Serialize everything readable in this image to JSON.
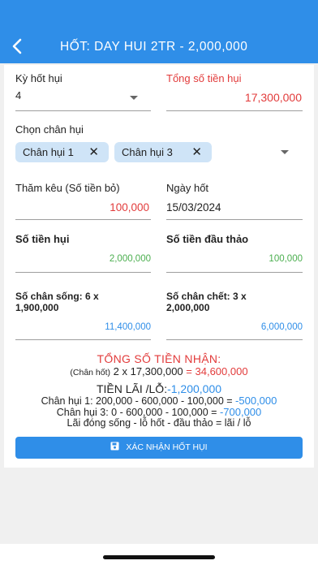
{
  "header": {
    "title": "HỐT: DAY HUI 2TR - 2,000,000"
  },
  "ky_hot": {
    "label": "Kỳ hốt hụi",
    "value": "4"
  },
  "tong_so_tien": {
    "label": "Tổng số tiền hụi",
    "value": "17,300,000"
  },
  "chon_chan": {
    "label": "Chọn chân hụi",
    "chips": [
      {
        "label": "Chân hụi 1"
      },
      {
        "label": "Chân hụi 3"
      }
    ]
  },
  "tham_keu": {
    "label": "Thăm kêu (Số tiền bỏ)",
    "value": "100,000"
  },
  "ngay_hot": {
    "label": "Ngày hốt",
    "value": "15/03/2024"
  },
  "so_tien_hui": {
    "label": "Số tiền hụi",
    "value": "2,000,000"
  },
  "so_tien_dau_thao": {
    "label": "Số tiền đầu thảo",
    "value": "100,000"
  },
  "so_chan_song": {
    "label_line1": "Số chân sống:  6 x",
    "label_line2": "1,900,000",
    "value": "11,400,000"
  },
  "so_chan_chet": {
    "label_line1": "Số chân chết: 3 x",
    "label_line2": "2,000,000",
    "value": "6,000,000"
  },
  "summary": {
    "tong_nhan_title": "TỔNG SỐ TIỀN NHẬN:",
    "tong_nhan_prefix": "(Chân hốt)",
    "tong_nhan_formula": "2 x 17,300,000",
    "tong_nhan_result": "= 34,600,000",
    "lai_lo_label": "TIỀN LÃI /LỖ:",
    "lai_lo_value": "-1,200,000",
    "chan1_label": "Chân hụi 1:  200,000 - 600,000 - 100,000 =",
    "chan1_value": "-500,000",
    "chan3_label": "Chân hụi 3:  0 - 600,000 - 100,000 =",
    "chan3_value": "-700,000",
    "note": "Lãi đóng sống - lỗ hốt - đầu thảo = lãi / lỗ"
  },
  "confirm_button": {
    "label": "XÁC NHẬN HỐT HỤI"
  },
  "colors": {
    "primary": "#2f8ee8",
    "red": "#e23b3b",
    "green": "#4caf50",
    "blue": "#2f8ee8",
    "chip": "#cfe4f7"
  }
}
